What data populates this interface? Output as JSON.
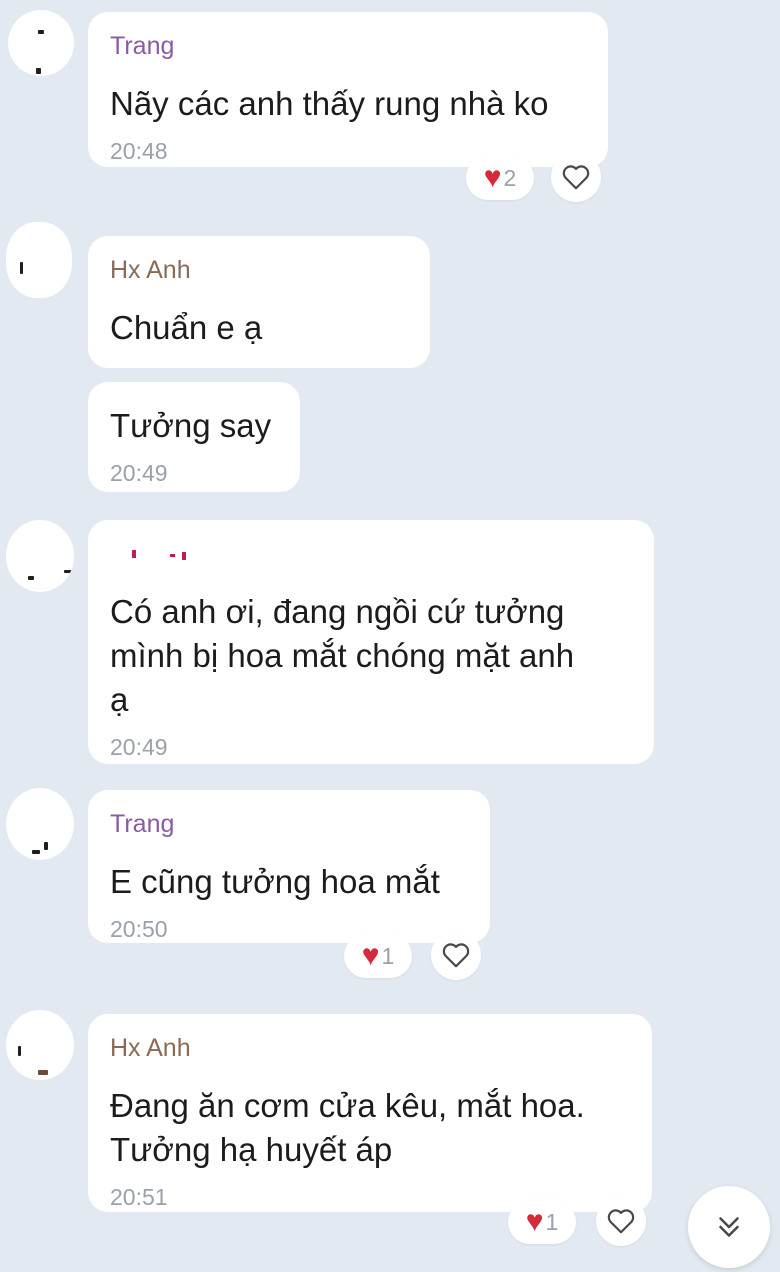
{
  "messages": [
    {
      "sender": "Trang",
      "lines": [
        "Nãy các anh thấy rung nhà ko"
      ],
      "time": "20:48",
      "reaction_count": "2"
    },
    {
      "sender": "Hx Anh",
      "lines": [
        "Chuẩn e ạ"
      ]
    },
    {
      "lines": [
        "Tưởng say"
      ],
      "time": "20:49"
    },
    {
      "lines": [
        "Có anh ơi, đang ngồi cứ tưởng",
        "mình bị hoa mắt chóng mặt anh",
        "ạ"
      ],
      "time": "20:49"
    },
    {
      "sender": "Trang",
      "lines": [
        "E cũng tưởng hoa mắt"
      ],
      "time": "20:50",
      "reaction_count": "1"
    },
    {
      "sender": "Hx Anh",
      "lines": [
        "Đang ăn cơm cửa kêu, mắt hoa.",
        "Tưởng hạ huyết áp"
      ],
      "time": "20:51",
      "reaction_count": "1"
    }
  ],
  "icons": {
    "reaction": "red-heart-icon",
    "like": "heart-outline-icon",
    "scroll": "double-chevron-down-icon"
  },
  "colors": {
    "background": "#e2e9f1",
    "bubble": "#ffffff",
    "sender_trang": "#8a5aa6",
    "sender_hx_anh": "#8a6a55",
    "time": "#9aa1aa",
    "heart": "#d62a3a"
  }
}
